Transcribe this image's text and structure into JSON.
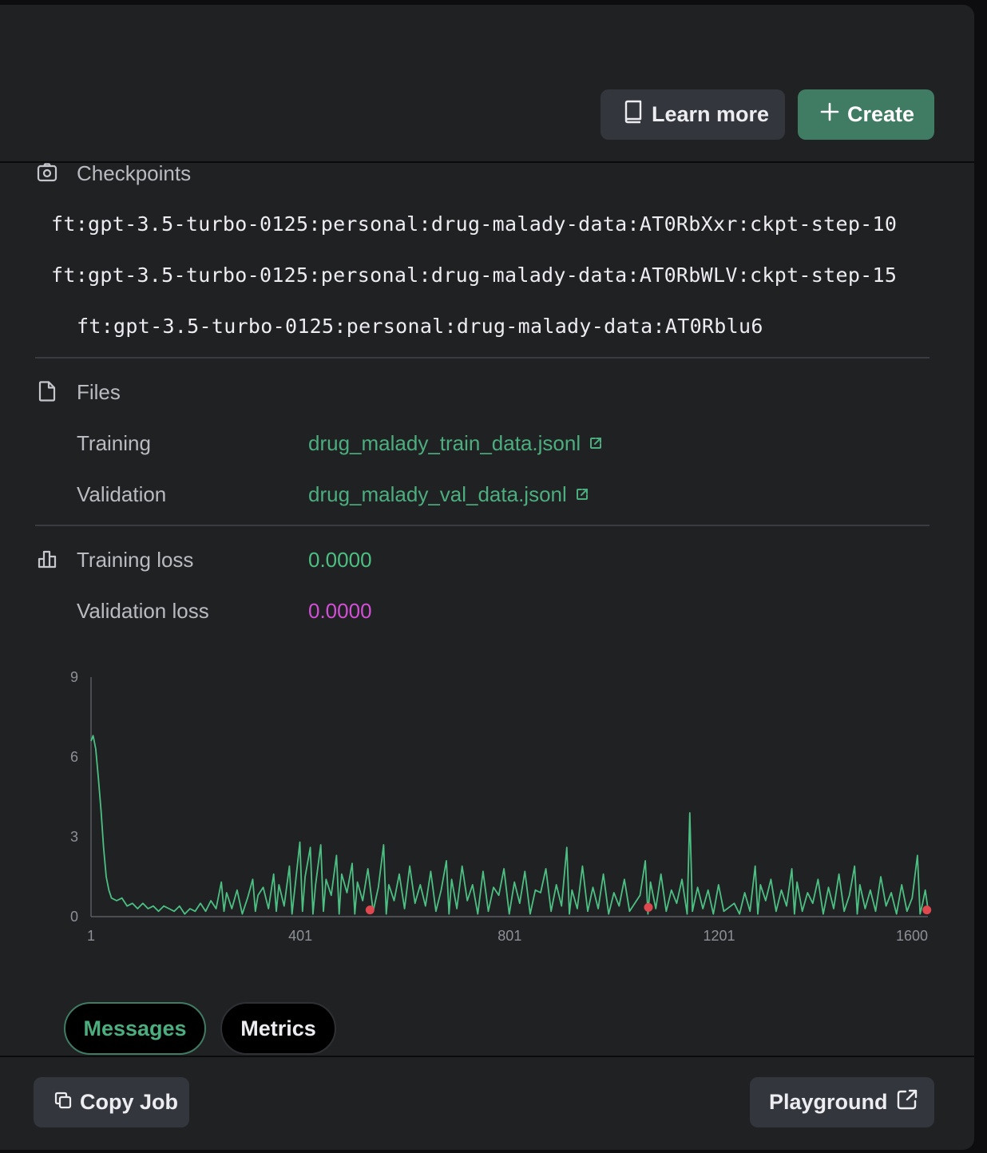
{
  "header": {
    "learn_more_label": "Learn more",
    "create_label": "Create"
  },
  "checkpoints": {
    "title": "Checkpoints",
    "items": [
      "ft:gpt-3.5-turbo-0125:personal:drug-malady-data:AT0RbXxr:ckpt-step-10",
      "ft:gpt-3.5-turbo-0125:personal:drug-malady-data:AT0RbWLV:ckpt-step-15",
      "ft:gpt-3.5-turbo-0125:personal:drug-malady-data:AT0Rblu6"
    ]
  },
  "files": {
    "title": "Files",
    "training_label": "Training",
    "training_file": "drug_malady_train_data.jsonl",
    "validation_label": "Validation",
    "validation_file": "drug_malady_val_data.jsonl"
  },
  "loss": {
    "training_label": "Training loss",
    "training_value": "0.0000",
    "validation_label": "Validation loss",
    "validation_value": "0.0000"
  },
  "colors": {
    "accent": "#3f7c63",
    "training_line": "#4cc083",
    "validation_point": "#e0484f",
    "validation_value": "#d34fd6",
    "link": "#4cae7f"
  },
  "chart_data": {
    "type": "line",
    "x_ticks": [
      "1",
      "401",
      "801",
      "1201",
      "1600"
    ],
    "y_ticks": [
      "0",
      "3",
      "6",
      "9"
    ],
    "xlim": [
      1,
      1600
    ],
    "ylim": [
      0,
      9
    ],
    "series": [
      {
        "type": "line",
        "color": "#4cc083",
        "points": [
          [
            1,
            6.6
          ],
          [
            5,
            6.8
          ],
          [
            10,
            6.3
          ],
          [
            15,
            5.2
          ],
          [
            20,
            4.0
          ],
          [
            25,
            2.6
          ],
          [
            30,
            1.5
          ],
          [
            35,
            1.0
          ],
          [
            40,
            0.7
          ],
          [
            50,
            0.6
          ],
          [
            60,
            0.7
          ],
          [
            70,
            0.4
          ],
          [
            80,
            0.5
          ],
          [
            90,
            0.3
          ],
          [
            100,
            0.5
          ],
          [
            110,
            0.3
          ],
          [
            120,
            0.4
          ],
          [
            130,
            0.2
          ],
          [
            140,
            0.4
          ],
          [
            150,
            0.3
          ],
          [
            160,
            0.2
          ],
          [
            170,
            0.4
          ],
          [
            180,
            0.1
          ],
          [
            190,
            0.3
          ],
          [
            200,
            0.2
          ],
          [
            210,
            0.5
          ],
          [
            220,
            0.2
          ],
          [
            230,
            0.6
          ],
          [
            240,
            0.3
          ],
          [
            250,
            1.3
          ],
          [
            255,
            0.2
          ],
          [
            260,
            0.9
          ],
          [
            270,
            0.3
          ],
          [
            280,
            1.0
          ],
          [
            290,
            0.1
          ],
          [
            300,
            0.7
          ],
          [
            310,
            1.4
          ],
          [
            315,
            0.2
          ],
          [
            320,
            0.8
          ],
          [
            330,
            1.1
          ],
          [
            340,
            0.3
          ],
          [
            350,
            1.6
          ],
          [
            355,
            0.2
          ],
          [
            360,
            1.2
          ],
          [
            370,
            0.4
          ],
          [
            380,
            1.9
          ],
          [
            385,
            0.1
          ],
          [
            390,
            1.0
          ],
          [
            400,
            2.8
          ],
          [
            405,
            0.2
          ],
          [
            410,
            1.5
          ],
          [
            420,
            2.6
          ],
          [
            425,
            0.1
          ],
          [
            430,
            1.2
          ],
          [
            440,
            2.7
          ],
          [
            445,
            0.2
          ],
          [
            450,
            1.4
          ],
          [
            460,
            0.8
          ],
          [
            470,
            2.3
          ],
          [
            475,
            0.1
          ],
          [
            480,
            1.6
          ],
          [
            490,
            0.9
          ],
          [
            500,
            2.0
          ],
          [
            505,
            0.1
          ],
          [
            510,
            1.3
          ],
          [
            520,
            0.6
          ],
          [
            530,
            1.8
          ],
          [
            540,
            0.2
          ],
          [
            550,
            1.1
          ],
          [
            560,
            2.7
          ],
          [
            565,
            0.1
          ],
          [
            570,
            1.2
          ],
          [
            580,
            0.6
          ],
          [
            590,
            1.6
          ],
          [
            600,
            0.3
          ],
          [
            610,
            1.9
          ],
          [
            620,
            0.5
          ],
          [
            630,
            1.2
          ],
          [
            640,
            0.4
          ],
          [
            650,
            1.7
          ],
          [
            660,
            0.2
          ],
          [
            670,
            1.0
          ],
          [
            680,
            2.1
          ],
          [
            685,
            0.1
          ],
          [
            690,
            1.4
          ],
          [
            700,
            0.3
          ],
          [
            710,
            1.9
          ],
          [
            720,
            0.6
          ],
          [
            730,
            1.2
          ],
          [
            740,
            0.1
          ],
          [
            750,
            1.7
          ],
          [
            760,
            0.2
          ],
          [
            770,
            1.1
          ],
          [
            780,
            0.8
          ],
          [
            790,
            1.8
          ],
          [
            800,
            0.1
          ],
          [
            810,
            1.3
          ],
          [
            820,
            0.5
          ],
          [
            830,
            1.7
          ],
          [
            840,
            0.1
          ],
          [
            850,
            1.0
          ],
          [
            860,
            0.9
          ],
          [
            870,
            1.8
          ],
          [
            880,
            0.2
          ],
          [
            890,
            1.2
          ],
          [
            900,
            0.4
          ],
          [
            910,
            2.6
          ],
          [
            915,
            0.1
          ],
          [
            920,
            1.0
          ],
          [
            930,
            0.3
          ],
          [
            940,
            1.9
          ],
          [
            950,
            0.2
          ],
          [
            960,
            1.1
          ],
          [
            970,
            0.3
          ],
          [
            980,
            1.6
          ],
          [
            990,
            0.1
          ],
          [
            1000,
            0.9
          ],
          [
            1010,
            0.4
          ],
          [
            1020,
            1.4
          ],
          [
            1030,
            0.2
          ],
          [
            1050,
            0.8
          ],
          [
            1060,
            2.1
          ],
          [
            1065,
            0.1
          ],
          [
            1070,
            1.3
          ],
          [
            1080,
            0.3
          ],
          [
            1090,
            1.6
          ],
          [
            1100,
            0.2
          ],
          [
            1110,
            1.0
          ],
          [
            1120,
            0.5
          ],
          [
            1130,
            1.4
          ],
          [
            1140,
            0.1
          ],
          [
            1145,
            3.9
          ],
          [
            1150,
            0.2
          ],
          [
            1160,
            1.1
          ],
          [
            1170,
            0.3
          ],
          [
            1180,
            1.0
          ],
          [
            1190,
            0.1
          ],
          [
            1200,
            1.2
          ],
          [
            1210,
            0.2
          ],
          [
            1230,
            0.5
          ],
          [
            1240,
            0.1
          ],
          [
            1250,
            0.9
          ],
          [
            1260,
            0.2
          ],
          [
            1270,
            1.9
          ],
          [
            1275,
            0.1
          ],
          [
            1280,
            1.2
          ],
          [
            1290,
            0.6
          ],
          [
            1300,
            1.4
          ],
          [
            1310,
            0.2
          ],
          [
            1320,
            1.0
          ],
          [
            1330,
            0.4
          ],
          [
            1340,
            1.8
          ],
          [
            1345,
            0.1
          ],
          [
            1350,
            1.3
          ],
          [
            1360,
            0.2
          ],
          [
            1370,
            0.9
          ],
          [
            1380,
            0.5
          ],
          [
            1390,
            1.4
          ],
          [
            1400,
            0.1
          ],
          [
            1410,
            1.1
          ],
          [
            1420,
            0.3
          ],
          [
            1430,
            1.6
          ],
          [
            1440,
            0.2
          ],
          [
            1450,
            0.8
          ],
          [
            1460,
            1.9
          ],
          [
            1465,
            0.1
          ],
          [
            1470,
            1.2
          ],
          [
            1480,
            0.3
          ],
          [
            1490,
            1.0
          ],
          [
            1500,
            0.2
          ],
          [
            1510,
            1.5
          ],
          [
            1520,
            0.4
          ],
          [
            1530,
            0.9
          ],
          [
            1540,
            0.1
          ],
          [
            1550,
            1.2
          ],
          [
            1560,
            0.2
          ],
          [
            1570,
            0.7
          ],
          [
            1580,
            2.3
          ],
          [
            1585,
            0.1
          ],
          [
            1590,
            0.5
          ],
          [
            1595,
            1.0
          ],
          [
            1600,
            0.3
          ]
        ]
      },
      {
        "type": "scatter",
        "color": "#e0484f",
        "points": [
          [
            534,
            0.25
          ],
          [
            1066,
            0.35
          ],
          [
            1598,
            0.25
          ]
        ]
      }
    ]
  },
  "tabs": {
    "messages_label": "Messages",
    "metrics_label": "Metrics"
  },
  "footer": {
    "copy_job_label": "Copy Job",
    "playground_label": "Playground"
  }
}
